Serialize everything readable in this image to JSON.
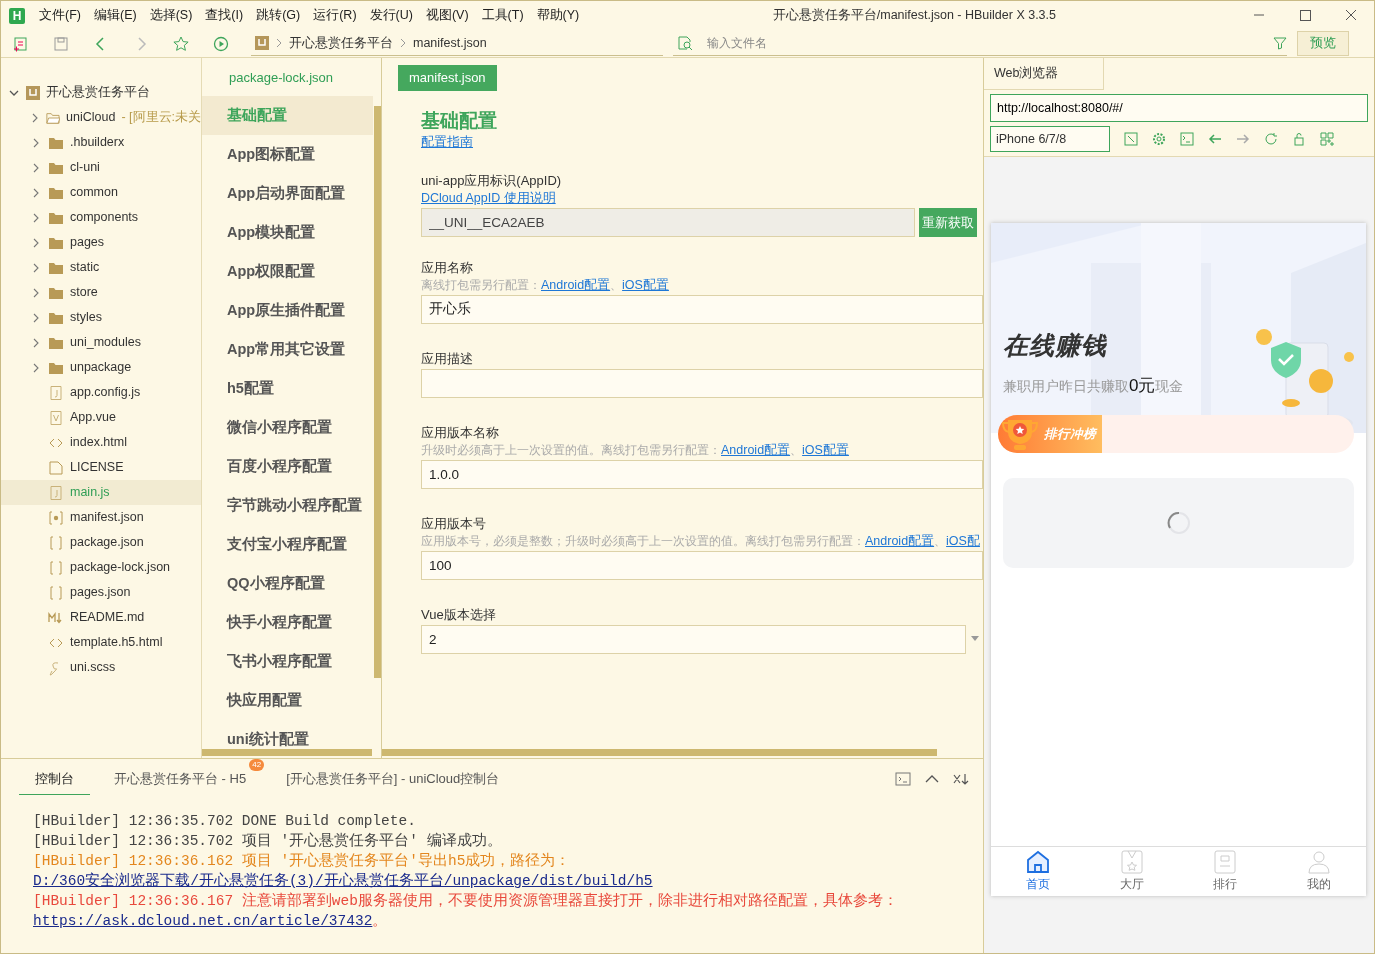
{
  "window": {
    "logo": "H",
    "title": "开心悬赏任务平台/manifest.json - HBuilder X 3.3.5",
    "menu": [
      "文件(F)",
      "编辑(E)",
      "选择(S)",
      "查找(I)",
      "跳转(G)",
      "运行(R)",
      "发行(U)",
      "视图(V)",
      "工具(T)",
      "帮助(Y)"
    ]
  },
  "toolbar": {
    "breadcrumb": [
      "开心悬赏任务平台",
      "manifest.json"
    ],
    "file_search": {
      "placeholder": "输入文件名"
    },
    "preview_button": "预览"
  },
  "file_tree": {
    "label": "开心悬赏任务平台",
    "expanded": true,
    "children": [
      {
        "label": "uniCloud",
        "note": "- [阿里云:未关",
        "kind": "cloud-folder",
        "expanded": false,
        "selected": false
      },
      {
        "label": ".hbuilderx",
        "kind": "folder",
        "expanded": false,
        "selected": false
      },
      {
        "label": "cl-uni",
        "kind": "folder",
        "expanded": false,
        "selected": false
      },
      {
        "label": "common",
        "kind": "folder",
        "expanded": false,
        "selected": false
      },
      {
        "label": "components",
        "kind": "folder",
        "expanded": false,
        "selected": false
      },
      {
        "label": "pages",
        "kind": "folder",
        "expanded": false,
        "selected": false
      },
      {
        "label": "static",
        "kind": "folder",
        "expanded": false,
        "selected": false
      },
      {
        "label": "store",
        "kind": "folder",
        "expanded": false,
        "selected": false
      },
      {
        "label": "styles",
        "kind": "folder",
        "expanded": false,
        "selected": false
      },
      {
        "label": "uni_modules",
        "kind": "folder",
        "expanded": false,
        "selected": false
      },
      {
        "label": "unpackage",
        "kind": "folder",
        "expanded": false,
        "selected": false
      },
      {
        "label": "app.config.js",
        "kind": "js",
        "selected": false
      },
      {
        "label": "App.vue",
        "kind": "vue",
        "selected": false
      },
      {
        "label": "index.html",
        "kind": "html",
        "selected": false
      },
      {
        "label": "LICENSE",
        "kind": "plain",
        "selected": false
      },
      {
        "label": "main.js",
        "kind": "js",
        "selected": true
      },
      {
        "label": "manifest.json",
        "kind": "manifest",
        "selected": false
      },
      {
        "label": "package.json",
        "kind": "json",
        "selected": false
      },
      {
        "label": "package-lock.json",
        "kind": "json",
        "selected": false
      },
      {
        "label": "pages.json",
        "kind": "json",
        "selected": false
      },
      {
        "label": "README.md",
        "kind": "md",
        "selected": false
      },
      {
        "label": "template.h5.html",
        "kind": "html",
        "selected": false
      },
      {
        "label": "uni.scss",
        "kind": "scss",
        "selected": false
      }
    ]
  },
  "editor_tabs": [
    {
      "label": "package-lock.json",
      "selected": false
    },
    {
      "label": "manifest.json",
      "selected": true
    }
  ],
  "settings_nav": [
    {
      "label": "基础配置",
      "selected": true
    },
    {
      "label": "App图标配置",
      "selected": false
    },
    {
      "label": "App启动界面配置",
      "selected": false
    },
    {
      "label": "App模块配置",
      "selected": false
    },
    {
      "label": "App权限配置",
      "selected": false
    },
    {
      "label": "App原生插件配置",
      "selected": false
    },
    {
      "label": "App常用其它设置",
      "selected": false
    },
    {
      "label": "h5配置",
      "selected": false
    },
    {
      "label": "微信小程序配置",
      "selected": false
    },
    {
      "label": "百度小程序配置",
      "selected": false
    },
    {
      "label": "字节跳动小程序配置",
      "selected": false
    },
    {
      "label": "支付宝小程序配置",
      "selected": false
    },
    {
      "label": "QQ小程序配置",
      "selected": false
    },
    {
      "label": "快手小程序配置",
      "selected": false
    },
    {
      "label": "飞书小程序配置",
      "selected": false
    },
    {
      "label": "快应用配置",
      "selected": false
    },
    {
      "label": "uni统计配置",
      "selected": false
    }
  ],
  "form": {
    "title": "基础配置",
    "guide_link": "配置指南",
    "fields": [
      {
        "kind": "text",
        "label": "uni-app应用标识(AppID)",
        "links": [
          "DCloud AppID 使用说明"
        ],
        "value": "__UNI__ECA2AEB",
        "readonly": true,
        "button": "重新获取"
      },
      {
        "kind": "text",
        "label": "应用名称",
        "hint": "离线打包需另行配置：",
        "links": [
          "Android配置",
          "iOS配置"
        ],
        "value": "开心乐",
        "readonly": false
      },
      {
        "kind": "text",
        "label": "应用描述",
        "readonly": false
      },
      {
        "kind": "text",
        "label": "应用版本名称",
        "hint": "升级时必须高于上一次设置的值。离线打包需另行配置：",
        "links": [
          "Android配置",
          "iOS配置"
        ],
        "value": "1.0.0",
        "readonly": false
      },
      {
        "kind": "text",
        "label": "应用版本号",
        "hint": "应用版本号，必须是整数；升级时必须高于上一次设置的值。离线打包需另行配置：",
        "links": [
          "Android配置",
          "iOS配"
        ],
        "value": "100",
        "readonly": false
      },
      {
        "kind": "select",
        "label": "Vue版本选择",
        "value": "2",
        "readonly": false
      }
    ],
    "link_separator": "、"
  },
  "browser": {
    "tab": "Web浏览器",
    "url": "http://localhost:8080/#/",
    "device": "iPhone 6/7/8"
  },
  "phone": {
    "hero_title": "在线赚钱",
    "hero_text": "兼职用户昨日共赚取",
    "amount": "0元",
    "hero_suffix": "现金",
    "rank_banner": "排行冲榜",
    "loading": true,
    "tabbar": [
      {
        "label": "首页",
        "selected": true
      },
      {
        "label": "大厅",
        "selected": false
      },
      {
        "label": "排行",
        "selected": false
      },
      {
        "label": "我的",
        "selected": false
      }
    ]
  },
  "console": {
    "tabs": [
      {
        "label": "控制台",
        "selected": true
      },
      {
        "label": "开心悬赏任务平台 - H5",
        "badge": "42",
        "selected": false
      },
      {
        "label": "[开心悬赏任务平台] - uniCloud控制台",
        "selected": false
      }
    ],
    "lines": [
      {
        "kind": "info",
        "prefix": "[HBuilder]",
        "time": "12:36:35.702",
        "text": " DONE  Build complete."
      },
      {
        "kind": "info",
        "prefix": "[HBuilder]",
        "time": "12:36:35.702",
        "text": "项目 '开心悬赏任务平台' 编译成功。"
      },
      {
        "kind": "warn",
        "prefix": "[HBuilder]",
        "time": "12:36:36.162",
        "text": "项目 '开心悬赏任务平台'导出h5成功，路径为：",
        "link": "D:/360安全浏览器下载/开心悬赏任务(3)/开心悬赏任务平台/unpackage/dist/build/h5"
      },
      {
        "kind": "error",
        "prefix": "[HBuilder]",
        "time": "12:36:36.167",
        "text": "注意请部署到web服务器使用，不要使用资源管理器直接打开，除非进行相对路径配置，具体参考：",
        "link": "https://ask.dcloud.net.cn/article/37432",
        "after": "。"
      }
    ]
  }
}
